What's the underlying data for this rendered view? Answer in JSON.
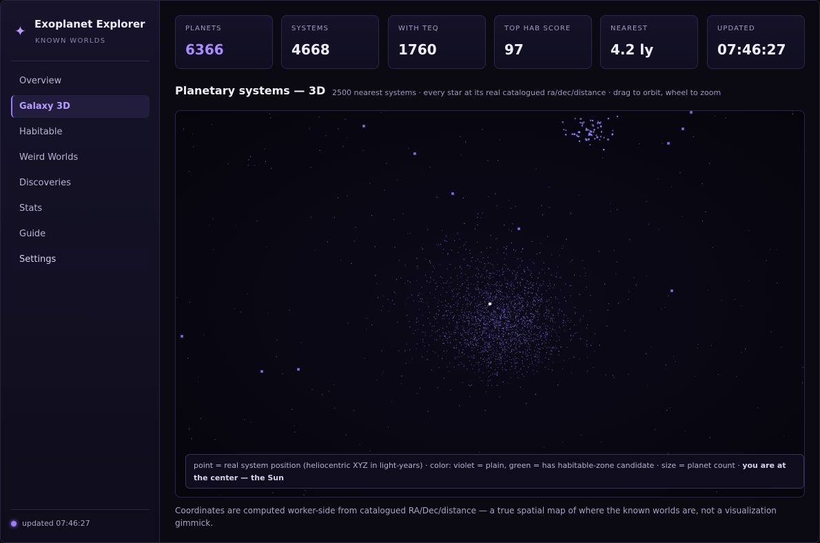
{
  "brand": {
    "icon": "sparkle-icon",
    "title": "Exoplanet Explorer",
    "subtitle": "KNOWN WORLDS"
  },
  "nav": {
    "items": [
      {
        "label": "Overview"
      },
      {
        "label": "Galaxy 3D"
      },
      {
        "label": "Habitable"
      },
      {
        "label": "Weird Worlds"
      },
      {
        "label": "Discoveries"
      },
      {
        "label": "Stats"
      },
      {
        "label": "Guide"
      },
      {
        "label": "Settings"
      }
    ],
    "active": "Galaxy 3D"
  },
  "sidebar_footer": {
    "updated": "updated 07:46:27"
  },
  "stats": [
    {
      "label": "PLANETS",
      "value": "6366"
    },
    {
      "label": "SYSTEMS",
      "value": "4668"
    },
    {
      "label": "WITH TEQ",
      "value": "1760"
    },
    {
      "label": "TOP HAB SCORE",
      "value": "97"
    },
    {
      "label": "NEAREST",
      "value": "4.2 ly"
    },
    {
      "label": "UPDATED",
      "value": "07:46:27"
    }
  ],
  "section": {
    "title": "Planetary systems — 3D",
    "subtitle": "2500 nearest systems · every star at its real catalogued ra/dec/distance · drag to orbit, wheel to zoom"
  },
  "legend": {
    "text": "point = real system position (heliocentric XYZ in light-years) · color: violet = plain, green = has habitable-zone candidate · size = planet count · ",
    "bold": "you are at the center — the Sun"
  },
  "footer": {
    "text": "Coordinates are computed worker-side from catalogued RA/Dec/distance — a true spatial map of where the known worlds are, not a visualization gimmick."
  },
  "colors": {
    "accent": "#9b7cff",
    "plain_point": "#8b74e8",
    "sun": "#e8e4f4"
  }
}
